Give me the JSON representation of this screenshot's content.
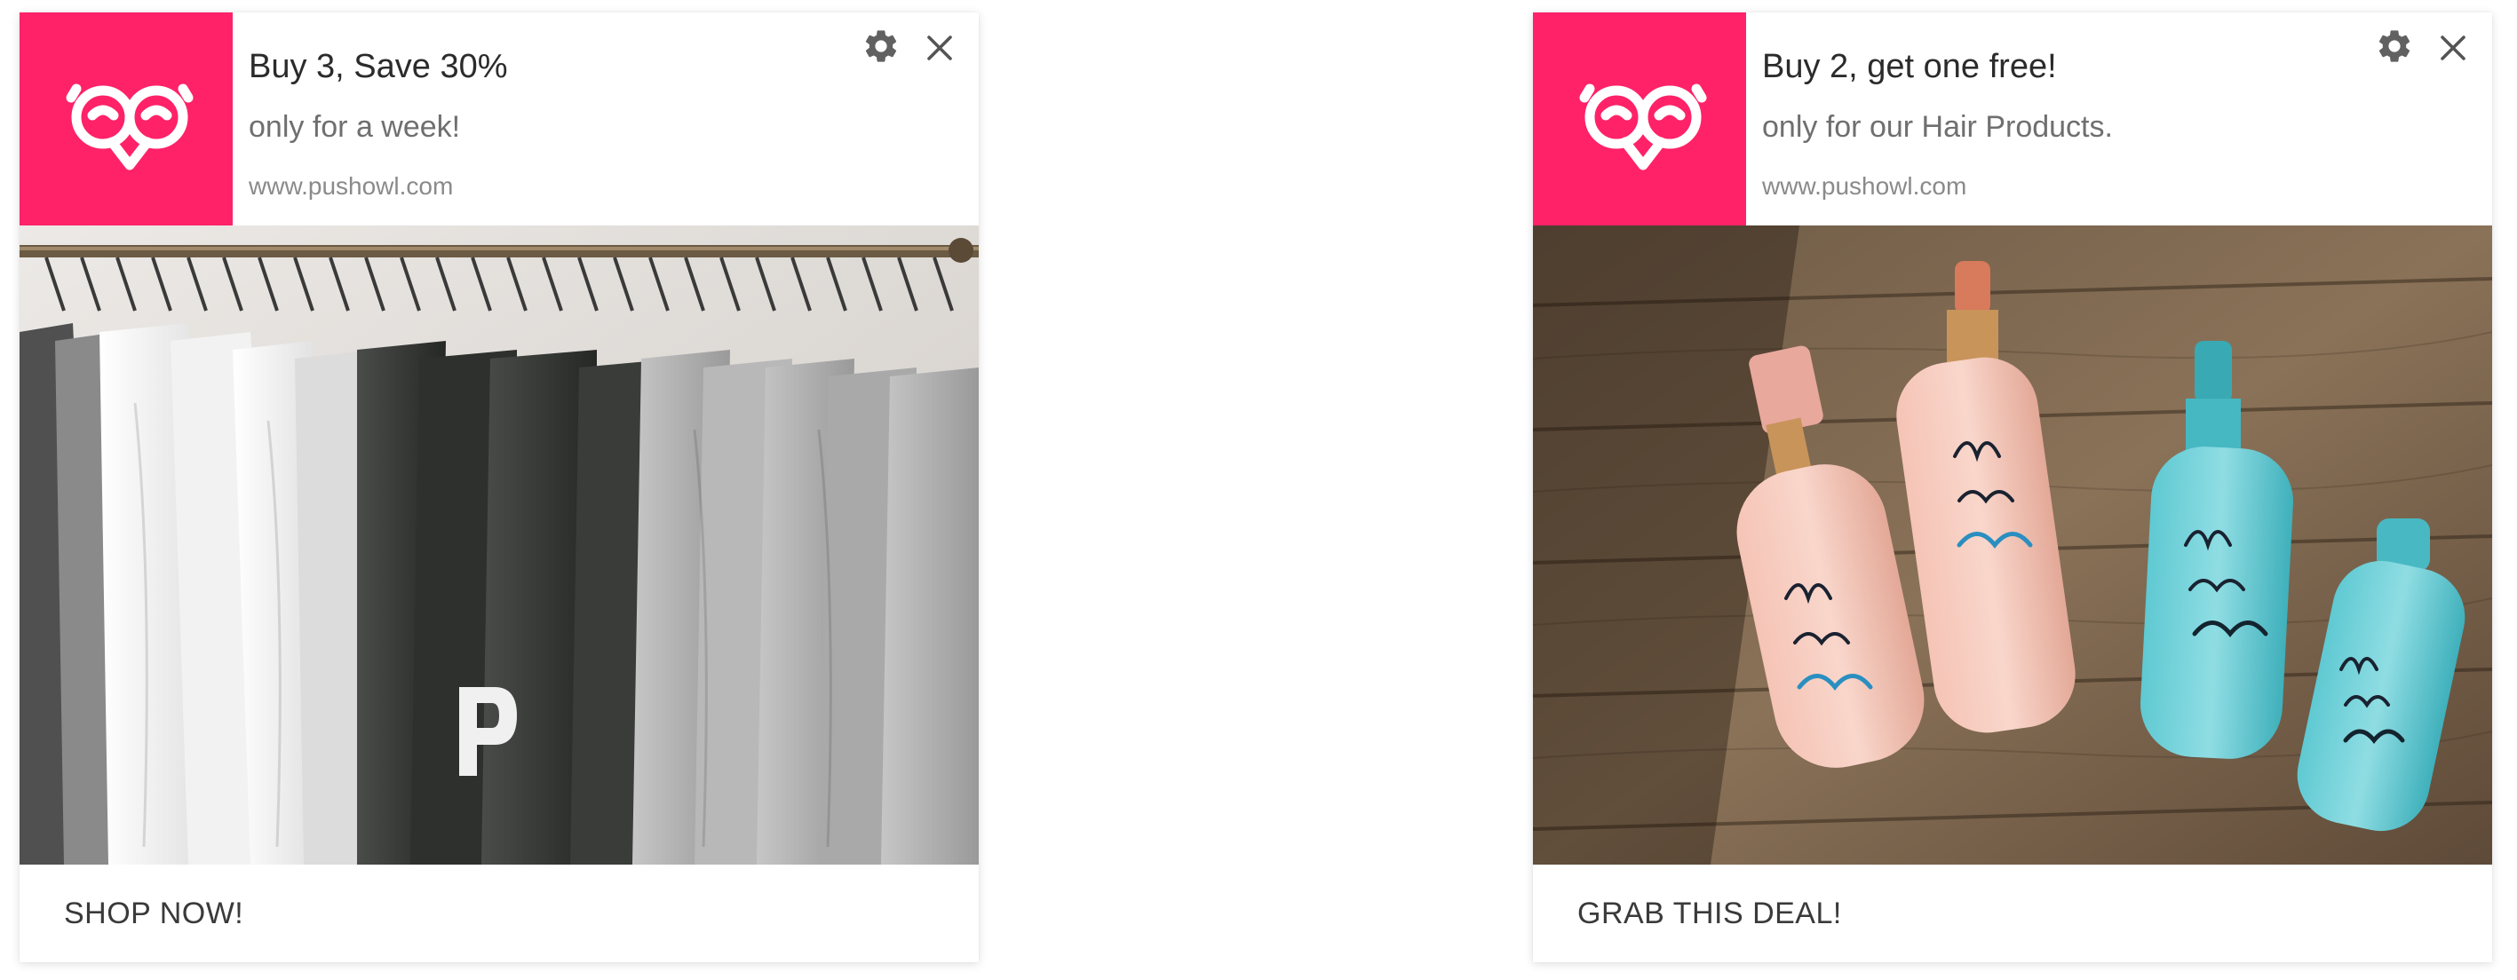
{
  "colors": {
    "brand": "#FF2268",
    "title_text": "#2b2b2b",
    "message_text": "#6f6f6f",
    "site_text": "#8a8a8a",
    "icon_gray": "#616161"
  },
  "notifications": [
    {
      "title": "Buy 3, Save 30%",
      "message": "only for a week!",
      "site": "www.pushowl.com",
      "image": "clothing-rack-hoodies-photo",
      "action_label": "SHOP NOW!",
      "icons": {
        "logo": "owl-logo-icon",
        "settings": "gear-icon",
        "close": "close-icon"
      }
    },
    {
      "title": "Buy 2, get one free!",
      "message": "only for our Hair Products.",
      "site": "www.pushowl.com",
      "image": "hair-product-bottles-photo",
      "action_label": "GRAB THIS DEAL!",
      "icons": {
        "logo": "owl-logo-icon",
        "settings": "gear-icon",
        "close": "close-icon"
      }
    }
  ]
}
